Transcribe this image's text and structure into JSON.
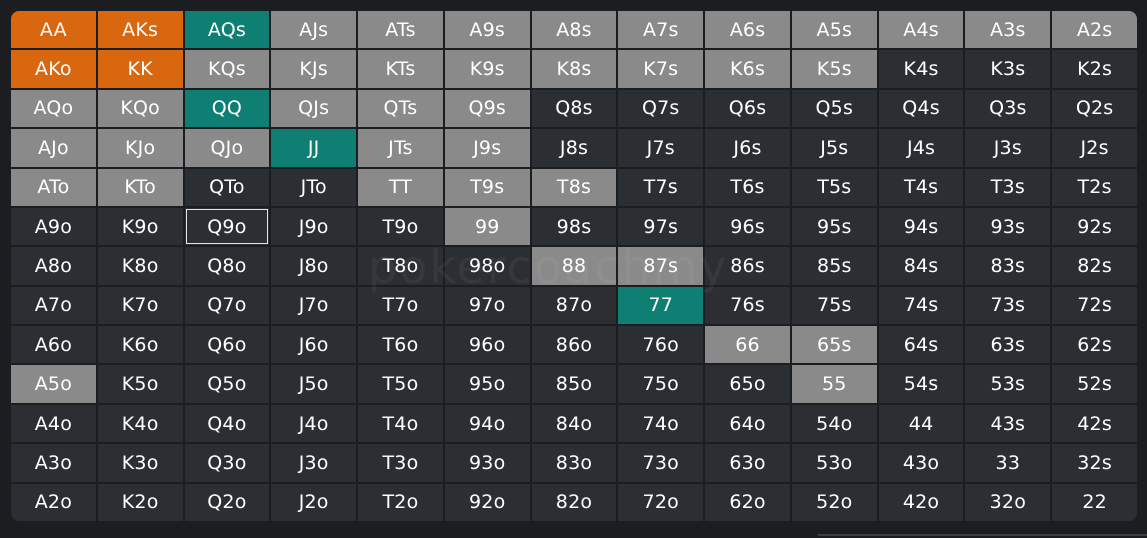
{
  "watermark": "pokercoachmy",
  "colors": {
    "raise": "#d9670f",
    "call": "#0f7f73",
    "fold": "#8a8a8a",
    "empty": "#2b2e33",
    "background": "#1b1d20"
  },
  "selected_hand": "Q9o",
  "grid": {
    "rows": [
      [
        [
          "AA",
          "raise"
        ],
        [
          "AKs",
          "raise"
        ],
        [
          "AQs",
          "call"
        ],
        [
          "AJs",
          "fold"
        ],
        [
          "ATs",
          "fold"
        ],
        [
          "A9s",
          "fold"
        ],
        [
          "A8s",
          "fold"
        ],
        [
          "A7s",
          "fold"
        ],
        [
          "A6s",
          "fold"
        ],
        [
          "A5s",
          "fold"
        ],
        [
          "A4s",
          "fold"
        ],
        [
          "A3s",
          "fold"
        ],
        [
          "A2s",
          "fold"
        ]
      ],
      [
        [
          "AKo",
          "raise"
        ],
        [
          "KK",
          "raise"
        ],
        [
          "KQs",
          "fold"
        ],
        [
          "KJs",
          "fold"
        ],
        [
          "KTs",
          "fold"
        ],
        [
          "K9s",
          "fold"
        ],
        [
          "K8s",
          "fold"
        ],
        [
          "K7s",
          "fold"
        ],
        [
          "K6s",
          "fold"
        ],
        [
          "K5s",
          "fold"
        ],
        [
          "K4s",
          "empty"
        ],
        [
          "K3s",
          "empty"
        ],
        [
          "K2s",
          "empty"
        ]
      ],
      [
        [
          "AQo",
          "fold"
        ],
        [
          "KQo",
          "fold"
        ],
        [
          "QQ",
          "call"
        ],
        [
          "QJs",
          "fold"
        ],
        [
          "QTs",
          "fold"
        ],
        [
          "Q9s",
          "fold"
        ],
        [
          "Q8s",
          "empty"
        ],
        [
          "Q7s",
          "empty"
        ],
        [
          "Q6s",
          "empty"
        ],
        [
          "Q5s",
          "empty"
        ],
        [
          "Q4s",
          "empty"
        ],
        [
          "Q3s",
          "empty"
        ],
        [
          "Q2s",
          "empty"
        ]
      ],
      [
        [
          "AJo",
          "fold"
        ],
        [
          "KJo",
          "fold"
        ],
        [
          "QJo",
          "fold"
        ],
        [
          "JJ",
          "call"
        ],
        [
          "JTs",
          "fold"
        ],
        [
          "J9s",
          "fold"
        ],
        [
          "J8s",
          "empty"
        ],
        [
          "J7s",
          "empty"
        ],
        [
          "J6s",
          "empty"
        ],
        [
          "J5s",
          "empty"
        ],
        [
          "J4s",
          "empty"
        ],
        [
          "J3s",
          "empty"
        ],
        [
          "J2s",
          "empty"
        ]
      ],
      [
        [
          "ATo",
          "fold"
        ],
        [
          "KTo",
          "fold"
        ],
        [
          "QTo",
          "empty"
        ],
        [
          "JTo",
          "empty"
        ],
        [
          "TT",
          "fold"
        ],
        [
          "T9s",
          "fold"
        ],
        [
          "T8s",
          "fold"
        ],
        [
          "T7s",
          "empty"
        ],
        [
          "T6s",
          "empty"
        ],
        [
          "T5s",
          "empty"
        ],
        [
          "T4s",
          "empty"
        ],
        [
          "T3s",
          "empty"
        ],
        [
          "T2s",
          "empty"
        ]
      ],
      [
        [
          "A9o",
          "empty"
        ],
        [
          "K9o",
          "empty"
        ],
        [
          "Q9o",
          "empty"
        ],
        [
          "J9o",
          "empty"
        ],
        [
          "T9o",
          "empty"
        ],
        [
          "99",
          "fold"
        ],
        [
          "98s",
          "empty"
        ],
        [
          "97s",
          "empty"
        ],
        [
          "96s",
          "empty"
        ],
        [
          "95s",
          "empty"
        ],
        [
          "94s",
          "empty"
        ],
        [
          "93s",
          "empty"
        ],
        [
          "92s",
          "empty"
        ]
      ],
      [
        [
          "A8o",
          "empty"
        ],
        [
          "K8o",
          "empty"
        ],
        [
          "Q8o",
          "empty"
        ],
        [
          "J8o",
          "empty"
        ],
        [
          "T8o",
          "empty"
        ],
        [
          "98o",
          "empty"
        ],
        [
          "88",
          "fold"
        ],
        [
          "87s",
          "fold"
        ],
        [
          "86s",
          "empty"
        ],
        [
          "85s",
          "empty"
        ],
        [
          "84s",
          "empty"
        ],
        [
          "83s",
          "empty"
        ],
        [
          "82s",
          "empty"
        ]
      ],
      [
        [
          "A7o",
          "empty"
        ],
        [
          "K7o",
          "empty"
        ],
        [
          "Q7o",
          "empty"
        ],
        [
          "J7o",
          "empty"
        ],
        [
          "T7o",
          "empty"
        ],
        [
          "97o",
          "empty"
        ],
        [
          "87o",
          "empty"
        ],
        [
          "77",
          "call"
        ],
        [
          "76s",
          "empty"
        ],
        [
          "75s",
          "empty"
        ],
        [
          "74s",
          "empty"
        ],
        [
          "73s",
          "empty"
        ],
        [
          "72s",
          "empty"
        ]
      ],
      [
        [
          "A6o",
          "empty"
        ],
        [
          "K6o",
          "empty"
        ],
        [
          "Q6o",
          "empty"
        ],
        [
          "J6o",
          "empty"
        ],
        [
          "T6o",
          "empty"
        ],
        [
          "96o",
          "empty"
        ],
        [
          "86o",
          "empty"
        ],
        [
          "76o",
          "empty"
        ],
        [
          "66",
          "fold"
        ],
        [
          "65s",
          "fold"
        ],
        [
          "64s",
          "empty"
        ],
        [
          "63s",
          "empty"
        ],
        [
          "62s",
          "empty"
        ]
      ],
      [
        [
          "A5o",
          "fold"
        ],
        [
          "K5o",
          "empty"
        ],
        [
          "Q5o",
          "empty"
        ],
        [
          "J5o",
          "empty"
        ],
        [
          "T5o",
          "empty"
        ],
        [
          "95o",
          "empty"
        ],
        [
          "85o",
          "empty"
        ],
        [
          "75o",
          "empty"
        ],
        [
          "65o",
          "empty"
        ],
        [
          "55",
          "fold"
        ],
        [
          "54s",
          "empty"
        ],
        [
          "53s",
          "empty"
        ],
        [
          "52s",
          "empty"
        ]
      ],
      [
        [
          "A4o",
          "empty"
        ],
        [
          "K4o",
          "empty"
        ],
        [
          "Q4o",
          "empty"
        ],
        [
          "J4o",
          "empty"
        ],
        [
          "T4o",
          "empty"
        ],
        [
          "94o",
          "empty"
        ],
        [
          "84o",
          "empty"
        ],
        [
          "74o",
          "empty"
        ],
        [
          "64o",
          "empty"
        ],
        [
          "54o",
          "empty"
        ],
        [
          "44",
          "empty"
        ],
        [
          "43s",
          "empty"
        ],
        [
          "42s",
          "empty"
        ]
      ],
      [
        [
          "A3o",
          "empty"
        ],
        [
          "K3o",
          "empty"
        ],
        [
          "Q3o",
          "empty"
        ],
        [
          "J3o",
          "empty"
        ],
        [
          "T3o",
          "empty"
        ],
        [
          "93o",
          "empty"
        ],
        [
          "83o",
          "empty"
        ],
        [
          "73o",
          "empty"
        ],
        [
          "63o",
          "empty"
        ],
        [
          "53o",
          "empty"
        ],
        [
          "43o",
          "empty"
        ],
        [
          "33",
          "empty"
        ],
        [
          "32s",
          "empty"
        ]
      ],
      [
        [
          "A2o",
          "empty"
        ],
        [
          "K2o",
          "empty"
        ],
        [
          "Q2o",
          "empty"
        ],
        [
          "J2o",
          "empty"
        ],
        [
          "T2o",
          "empty"
        ],
        [
          "92o",
          "empty"
        ],
        [
          "82o",
          "empty"
        ],
        [
          "72o",
          "empty"
        ],
        [
          "62o",
          "empty"
        ],
        [
          "52o",
          "empty"
        ],
        [
          "42o",
          "empty"
        ],
        [
          "32o",
          "empty"
        ],
        [
          "22",
          "empty"
        ]
      ]
    ]
  }
}
